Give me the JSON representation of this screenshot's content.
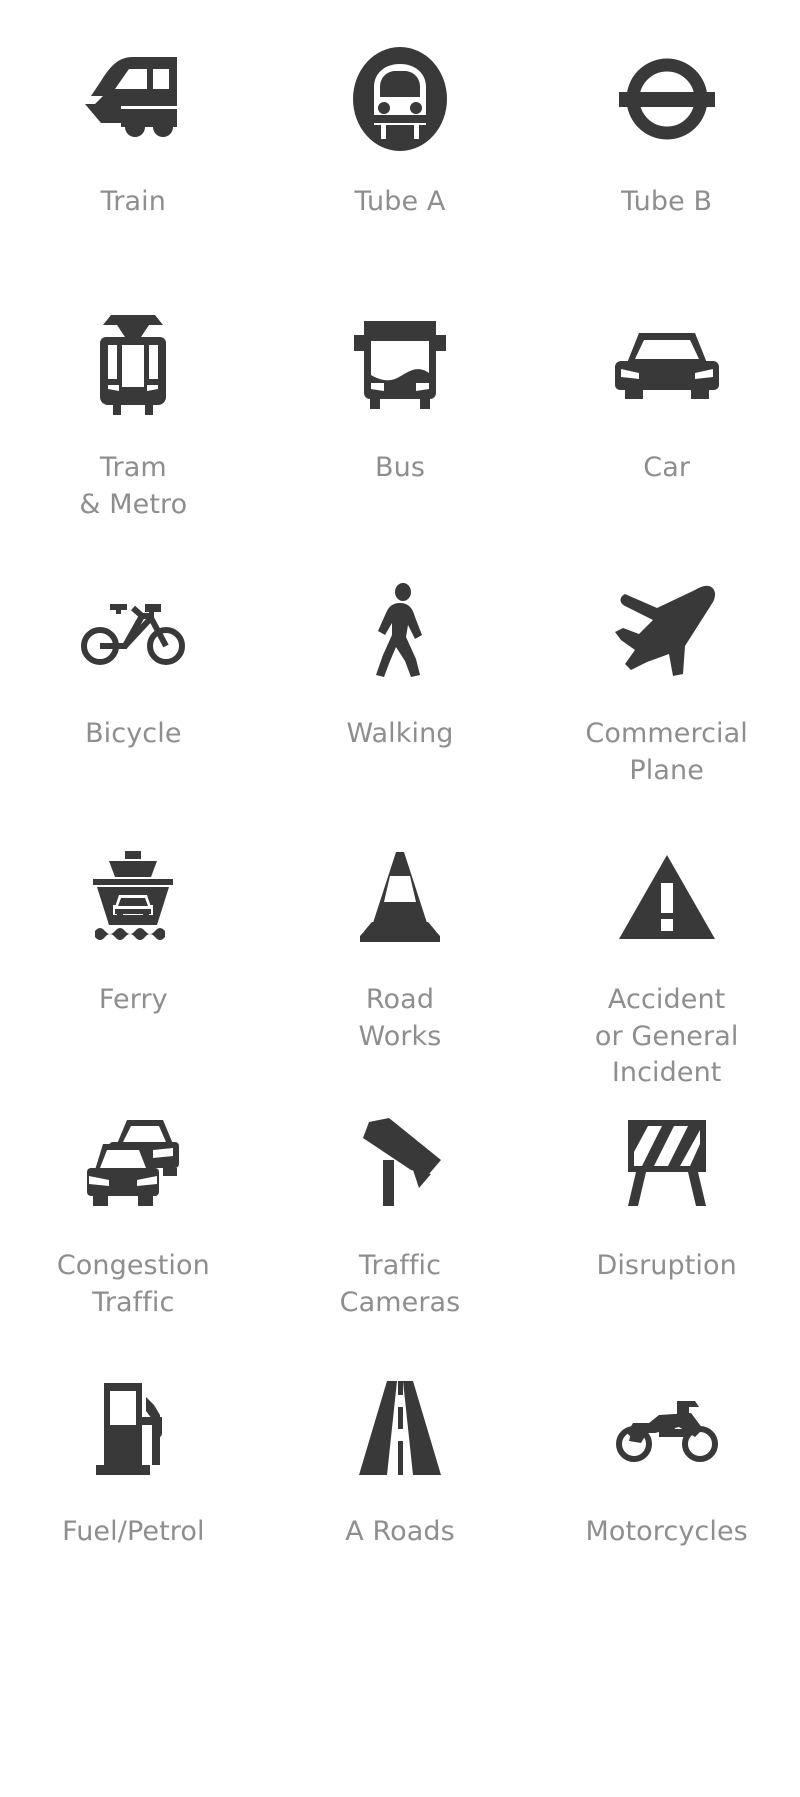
{
  "page": {
    "background_color": "#ffffff",
    "icon_color": "#393939",
    "label_color": "#8e8e8e",
    "columns": 3,
    "rows": 6,
    "total_icons": 18
  },
  "icons": [
    {
      "id": "train",
      "label": "Train",
      "icon_name": "train-icon"
    },
    {
      "id": "tube-a",
      "label": "Tube A",
      "icon_name": "tube-a-icon"
    },
    {
      "id": "tube-b",
      "label": "Tube B",
      "icon_name": "tube-b-roundel-icon"
    },
    {
      "id": "tram-metro",
      "label": "Tram\n& Metro",
      "icon_name": "tram-icon"
    },
    {
      "id": "bus",
      "label": "Bus",
      "icon_name": "bus-icon"
    },
    {
      "id": "car",
      "label": "Car",
      "icon_name": "car-icon"
    },
    {
      "id": "bicycle",
      "label": "Bicycle",
      "icon_name": "bicycle-icon"
    },
    {
      "id": "walking",
      "label": "Walking",
      "icon_name": "walking-person-icon"
    },
    {
      "id": "commercial-plane",
      "label": "Commercial\nPlane",
      "icon_name": "airplane-icon"
    },
    {
      "id": "ferry",
      "label": "Ferry",
      "icon_name": "ferry-icon"
    },
    {
      "id": "road-works",
      "label": "Road\nWorks",
      "icon_name": "traffic-cone-icon"
    },
    {
      "id": "accident",
      "label": "Accident\nor General\nIncident",
      "icon_name": "warning-triangle-icon"
    },
    {
      "id": "congestion",
      "label": "Congestion\nTraffic",
      "icon_name": "congestion-cars-icon"
    },
    {
      "id": "traffic-cameras",
      "label": "Traffic\nCameras",
      "icon_name": "traffic-camera-icon"
    },
    {
      "id": "disruption",
      "label": "Disruption",
      "icon_name": "road-barrier-icon"
    },
    {
      "id": "fuel-petrol",
      "label": "Fuel/Petrol",
      "icon_name": "fuel-pump-icon"
    },
    {
      "id": "a-roads",
      "label": "A Roads",
      "icon_name": "road-icon"
    },
    {
      "id": "motorcycles",
      "label": "Motorcycles",
      "icon_name": "motorcycle-icon"
    }
  ]
}
